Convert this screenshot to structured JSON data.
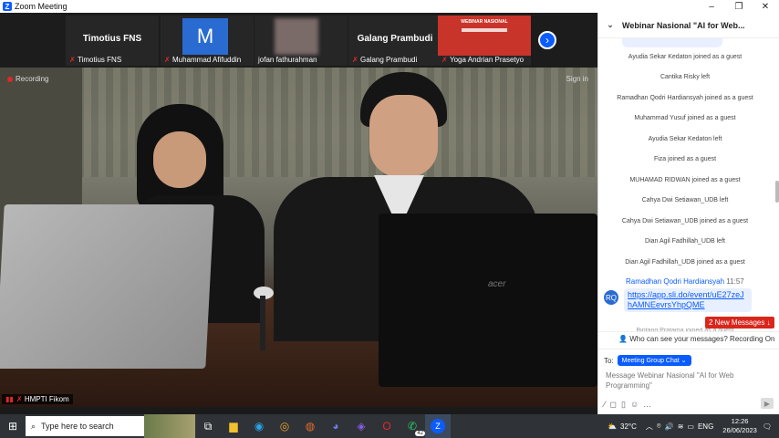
{
  "window": {
    "title": "Zoom Meeting"
  },
  "strip": {
    "tiles": [
      {
        "center_name": "Timotius FNS",
        "label": "Timotius FNS"
      },
      {
        "avatar_letter": "M",
        "label": "Muhammad Afifuddin"
      },
      {
        "label": "jofan fathurahman"
      },
      {
        "center_name": "Galang Prambudi",
        "label": "Galang Prambudi"
      },
      {
        "banner_text": "WEBINAR NASIONAL",
        "label": "Yoga Andrian Prasetyo"
      }
    ]
  },
  "video": {
    "recording": "Recording",
    "sign_in": "Sign in",
    "speaker": "HMPTI Fikom"
  },
  "chat": {
    "title": "Webinar Nasional \"AI for Web...",
    "system_messages": [
      "Ayudia Sekar Kedaton joined as a guest",
      "Cantika Risky left",
      "Ramadhan Qodri Hardiansyah joined as a guest",
      "Muhammad Yusuf joined as a guest",
      "Ayudia Sekar Kedaton left",
      "Fiza joined as a guest",
      "MUHAMAD RIDWAN joined as a guest",
      "Cahya Dwi Setiawan_UDB left",
      "Cahya Dwi Setiawan_UDB joined as a guest",
      "Dian Agil Fadhillah_UDB left",
      "Dian Agil Fadhillah_UDB joined as a guest"
    ],
    "message": {
      "avatar": "RQ",
      "sender": "Ramadhan Qodri Hardiansyah",
      "time": "11:57",
      "link": "https://app.sli.do/event/uE27zeJhAMNEevrsYhpQME"
    },
    "partial_line": "Bintang Pratama joined as a guest",
    "new_messages": "2 New Messages",
    "visibility": "Who can see your messages? Recording On",
    "to_label": "To:",
    "to_target": "Meeting Group Chat",
    "input_placeholder": "Message Webinar Nasional \"AI for Web Programming\""
  },
  "taskbar": {
    "search_placeholder": "Type here to search",
    "weather": "32°C",
    "lang": "ENG",
    "time": "12:26",
    "date": "26/06/2023",
    "whatsapp_badge": "42"
  }
}
